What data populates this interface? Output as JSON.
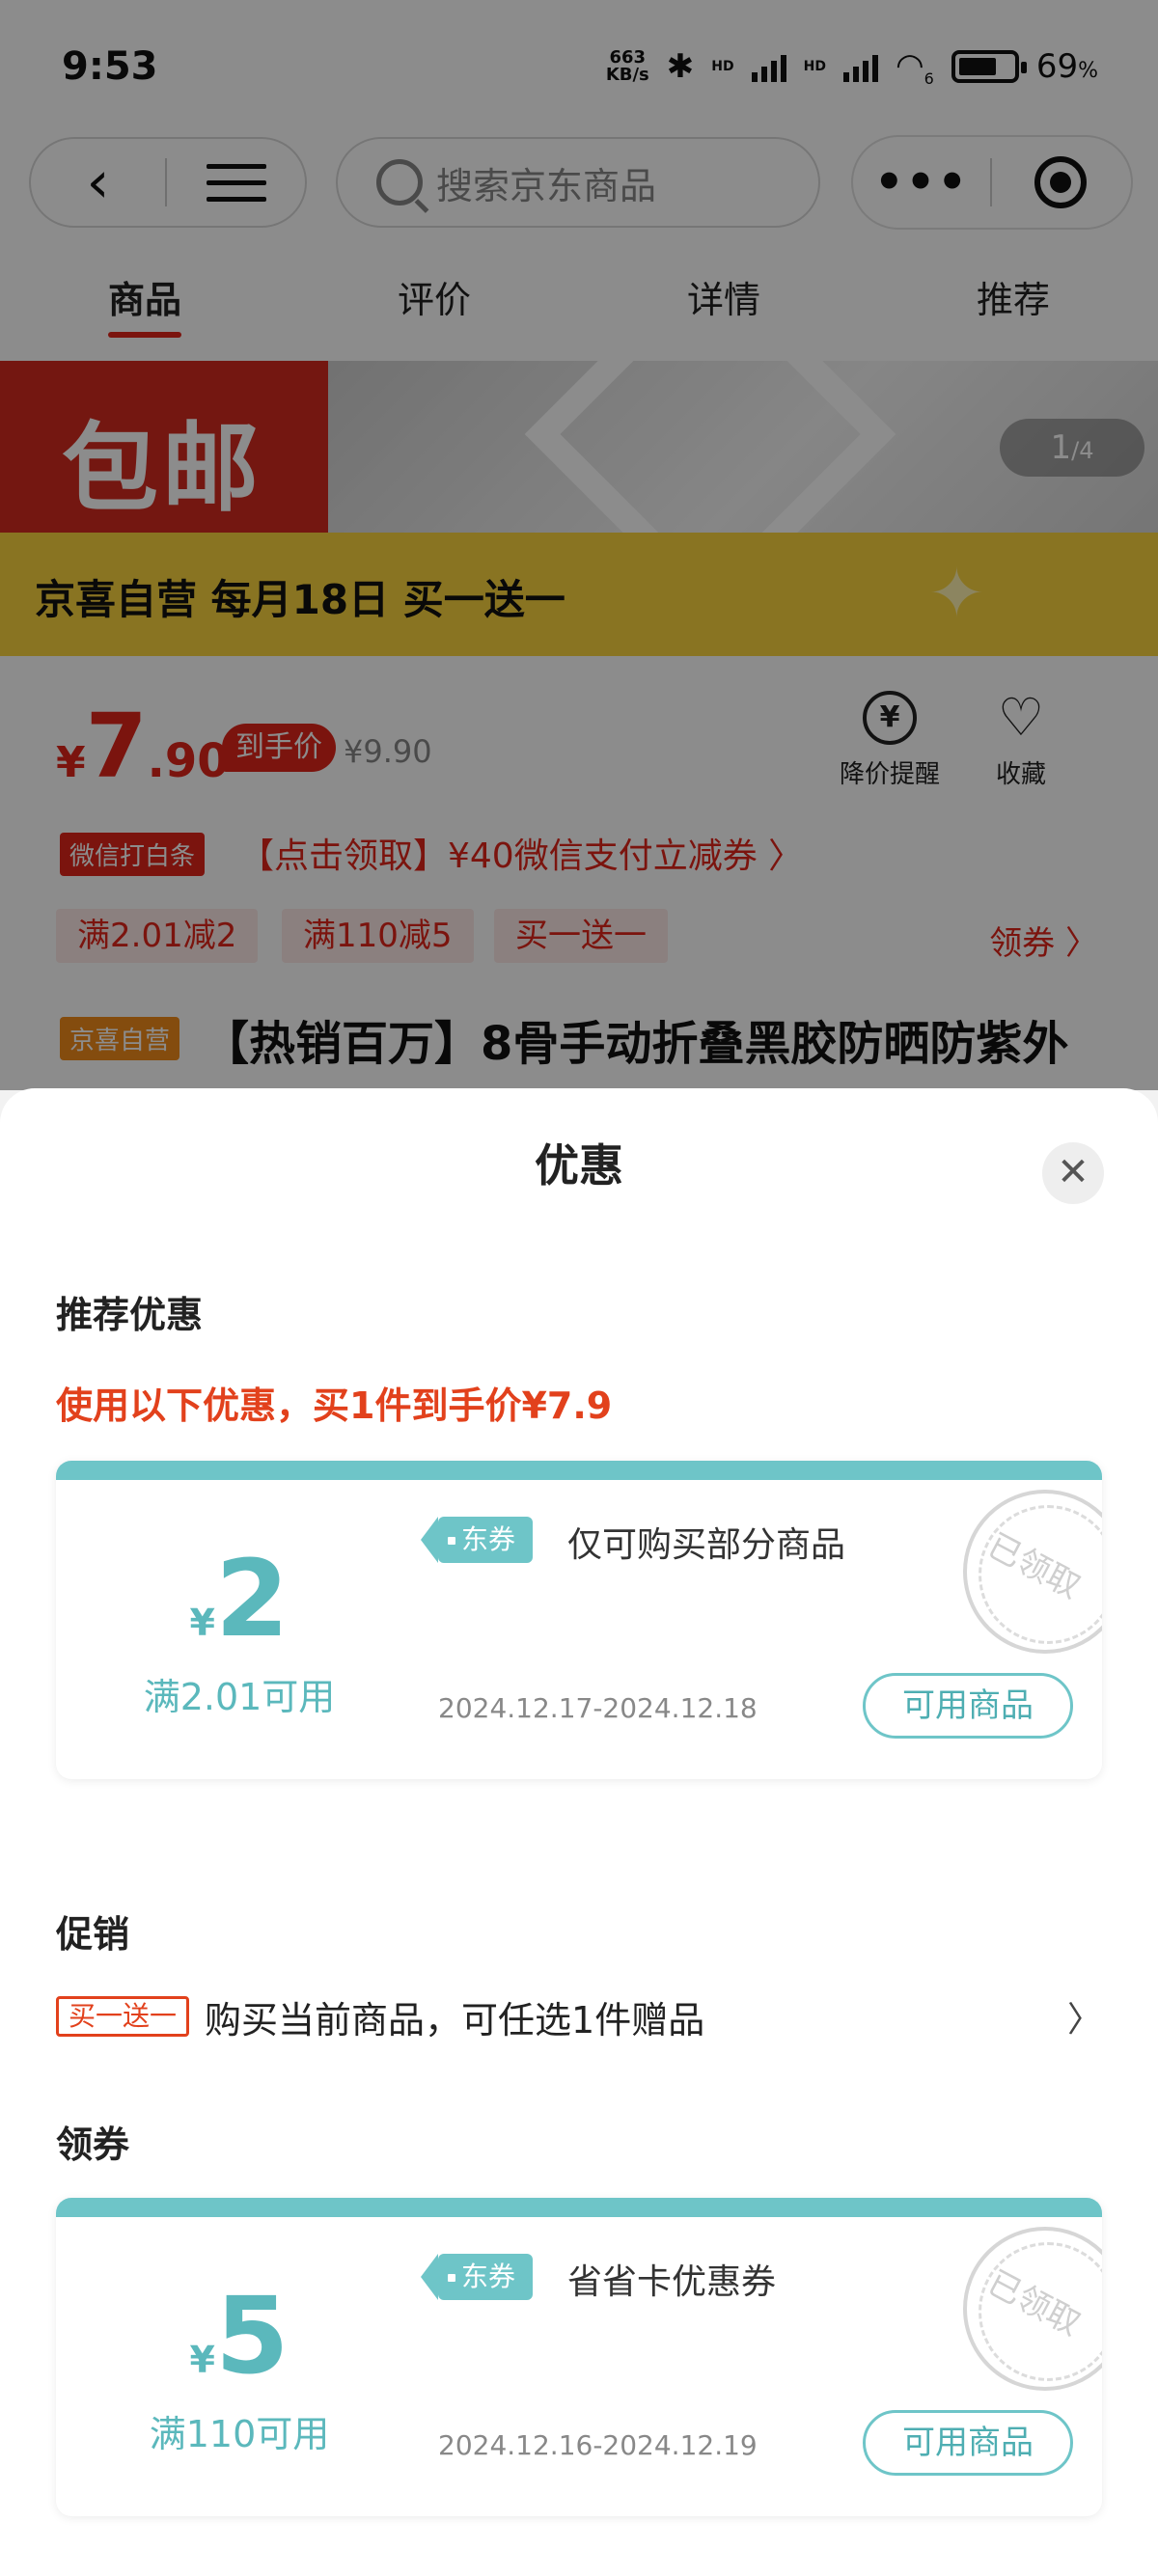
{
  "status_bar": {
    "time": "9:53",
    "net_speed": "663",
    "net_unit": "KB/s",
    "hd": "HD",
    "wifi_label": "6",
    "battery": "69",
    "battery_unit": "%"
  },
  "navbar": {
    "back_icon": "chevron-left-icon",
    "menu_icon": "menu-icon",
    "search_placeholder": "搜索京东商品",
    "more_glyph": "•••",
    "target_icon": "target-icon"
  },
  "tabs": [
    {
      "label": "商品",
      "active": true
    },
    {
      "label": "评价",
      "active": false
    },
    {
      "label": "详情",
      "active": false
    },
    {
      "label": "推荐",
      "active": false
    }
  ],
  "banner": {
    "red_text": "包邮",
    "page_current": "1",
    "page_total": "/4",
    "promo_text": "京喜自营 每月18日 买一送一"
  },
  "product": {
    "currency": "¥",
    "price_int": "7",
    "price_dec": ".90",
    "price_tag": "到手价",
    "original_price": "¥9.90",
    "price_alert": "降价提醒",
    "price_alert_glyph": "¥",
    "favorite": "收藏",
    "wechat_badge": "微信打白条",
    "wechat_text": "【点击领取】¥40微信支付立减券 〉",
    "chips": [
      "满2.01减2",
      "满110减5",
      "买一送一"
    ],
    "get_coupon": "领券 〉",
    "self_badge": "京喜自营",
    "title": "【热销百万】8骨手动折叠黑胶防晒防紫外"
  },
  "sheet": {
    "title": "优惠",
    "close_glyph": "✕",
    "recommend_title": "推荐优惠",
    "recommend_note": "使用以下优惠，买1件到手价¥7.9",
    "promotion_title": "促销",
    "promotion_badge": "买一送一",
    "promotion_text": "购买当前商品，可任选1件赠品",
    "promotion_chevron": "〉",
    "coupons_title": "领券",
    "coupons": [
      {
        "currency": "¥",
        "amount": "2",
        "condition": "满2.01可用",
        "tag": "东券",
        "description": "仅可购买部分商品",
        "date": "2024.12.17-2024.12.18",
        "button": "可用商品",
        "stamp": "已领取"
      },
      {
        "currency": "¥",
        "amount": "5",
        "condition": "满110可用",
        "tag": "东券",
        "description": "省省卡优惠券",
        "date": "2024.12.16-2024.12.19",
        "button": "可用商品",
        "stamp": "已领取"
      }
    ]
  },
  "colors": {
    "accent_red": "#e1251b",
    "coupon_teal": "#6ec5c8"
  }
}
